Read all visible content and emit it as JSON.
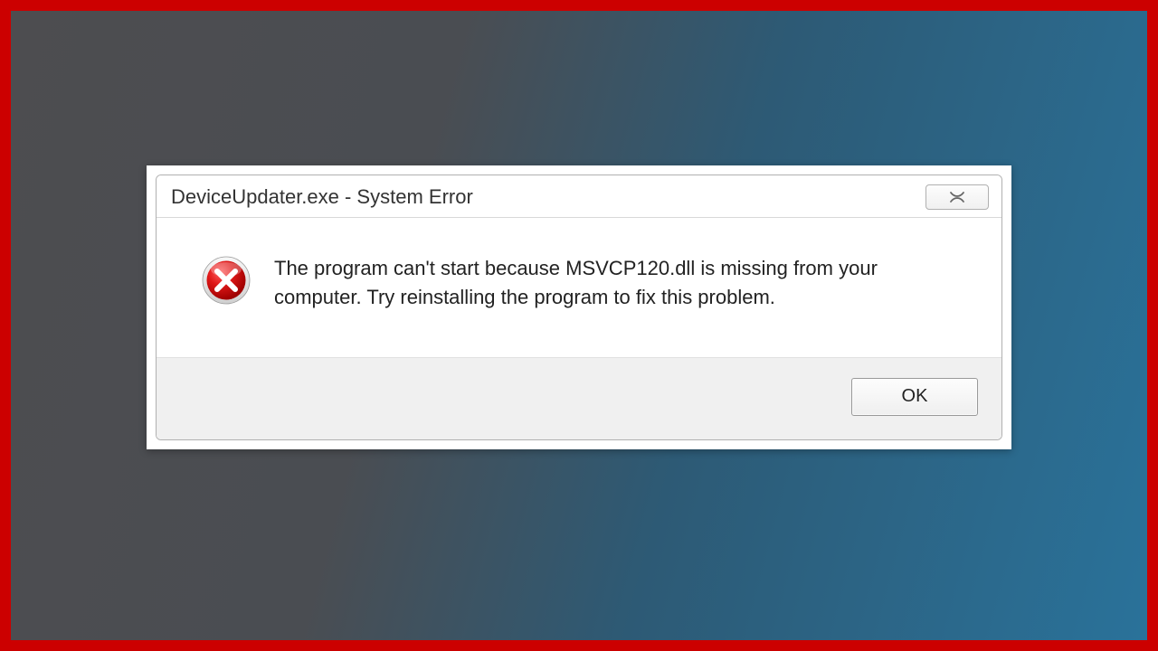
{
  "dialog": {
    "title": "DeviceUpdater.exe - System Error",
    "close_symbol": "✕",
    "message": "The program can't start because MSVCP120.dll is missing from your computer. Try reinstalling the program to fix this problem.",
    "ok_label": "OK"
  }
}
